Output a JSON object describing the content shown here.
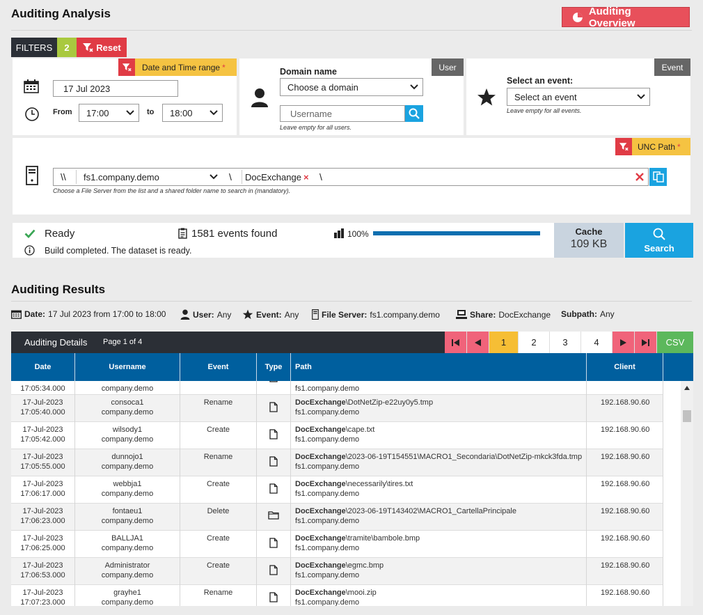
{
  "page": {
    "title": "Auditing Analysis",
    "overview_button": "Auditing Overview"
  },
  "filters": {
    "label": "FILTERS",
    "count": "2",
    "reset": "Reset"
  },
  "datetime": {
    "tag": "Date and Time range",
    "required": "*",
    "date": "17 Jul 2023",
    "from_label": "From",
    "from_value": "17:00",
    "to_label": "to",
    "to_value": "18:00"
  },
  "user": {
    "tag": "User",
    "domain_label": "Domain name",
    "domain_placeholder": "Choose a domain",
    "username_placeholder": "Username",
    "hint": "Leave empty for all users."
  },
  "event": {
    "tag": "Event",
    "label": "Select an event:",
    "placeholder": "Select an event",
    "hint": "Leave empty for all events."
  },
  "unc": {
    "tag": "UNC Path",
    "required": "*",
    "prefix": "\\\\",
    "server": "fs1.company.demo",
    "sep": "\\",
    "share": "DocExchange",
    "share_remove": "×",
    "trail": "\\",
    "hint": "Choose a File Server from the list and a shared folder name to search in (mandatory)."
  },
  "status": {
    "state": "Ready",
    "events_found": "1581 events found",
    "progress_text": "100%",
    "progress": 1.0,
    "message": "Build completed. The dataset is ready.",
    "cache_label": "Cache",
    "cache_value": "109 KB",
    "search_label": "Search"
  },
  "results": {
    "title": "Auditing Results",
    "summary": {
      "date_label": "Date:",
      "date_value": "17 Jul 2023 from 17:00 to 18:00",
      "user_label": "User:",
      "user_value": "Any",
      "event_label": "Event:",
      "event_value": "Any",
      "server_label": "File Server:",
      "server_value": "fs1.company.demo",
      "share_label": "Share:",
      "share_value": "DocExchange",
      "subpath_label": "Subpath:",
      "subpath_value": "Any"
    },
    "toolbar": {
      "title": "Auditing Details",
      "page_info": "Page 1 of 4",
      "pages": [
        "1",
        "2",
        "3",
        "4"
      ],
      "csv": "CSV"
    },
    "columns": [
      "Date",
      "Username",
      "Event",
      "Type",
      "Path",
      "Client"
    ],
    "partial_row": {
      "time": "17:05:34.000",
      "domain": "company.demo",
      "server": "fs1.company.demo"
    },
    "rows": [
      {
        "date": "17-Jul-2023",
        "time": "17:05:40.000",
        "user": "consoca1",
        "domain": "company.demo",
        "event": "Rename",
        "type": "file",
        "share": "DocExchange",
        "path": "\\DotNetZip-e22uy0y5.tmp",
        "server": "fs1.company.demo",
        "client": "192.168.90.60"
      },
      {
        "date": "17-Jul-2023",
        "time": "17:05:42.000",
        "user": "wilsody1",
        "domain": "company.demo",
        "event": "Create",
        "type": "file",
        "share": "DocExchange",
        "path": "\\cape.txt",
        "server": "fs1.company.demo",
        "client": "192.168.90.60"
      },
      {
        "date": "17-Jul-2023",
        "time": "17:05:55.000",
        "user": "dunnojo1",
        "domain": "company.demo",
        "event": "Rename",
        "type": "file",
        "share": "DocExchange",
        "path": "\\2023-06-19T154551\\MACRO1_Secondaria\\DotNetZip-mkck3fda.tmp",
        "server": "fs1.company.demo",
        "client": "192.168.90.60"
      },
      {
        "date": "17-Jul-2023",
        "time": "17:06:17.000",
        "user": "webbja1",
        "domain": "company.demo",
        "event": "Create",
        "type": "file",
        "share": "DocExchange",
        "path": "\\necessarily\\tires.txt",
        "server": "fs1.company.demo",
        "client": "192.168.90.60"
      },
      {
        "date": "17-Jul-2023",
        "time": "17:06:23.000",
        "user": "fontaeu1",
        "domain": "company.demo",
        "event": "Delete",
        "type": "folder",
        "share": "DocExchange",
        "path": "\\2023-06-19T143402\\MACRO1_CartellaPrincipale",
        "server": "fs1.company.demo",
        "client": "192.168.90.60"
      },
      {
        "date": "17-Jul-2023",
        "time": "17:06:25.000",
        "user": "BALLJA1",
        "domain": "company.demo",
        "event": "Create",
        "type": "file",
        "share": "DocExchange",
        "path": "\\tramite\\bambole.bmp",
        "server": "fs1.company.demo",
        "client": "192.168.90.60"
      },
      {
        "date": "17-Jul-2023",
        "time": "17:06:53.000",
        "user": "Administrator",
        "domain": "company.demo",
        "event": "Create",
        "type": "file",
        "share": "DocExchange",
        "path": "\\egmc.bmp",
        "server": "fs1.company.demo",
        "client": "192.168.90.60"
      },
      {
        "date": "17-Jul-2023",
        "time": "17:07:23.000",
        "user": "grayhe1",
        "domain": "company.demo",
        "event": "Rename",
        "type": "file",
        "share": "DocExchange",
        "path": "\\mooi.zip",
        "server": "fs1.company.demo",
        "client": "192.168.90.60"
      }
    ]
  },
  "colors": {
    "accent_blue": "#1aa3e0",
    "header_blue": "#005f9e",
    "danger": "#e03b45",
    "warning": "#f5c342",
    "success": "#3aa655",
    "dark": "#2b2f36"
  }
}
